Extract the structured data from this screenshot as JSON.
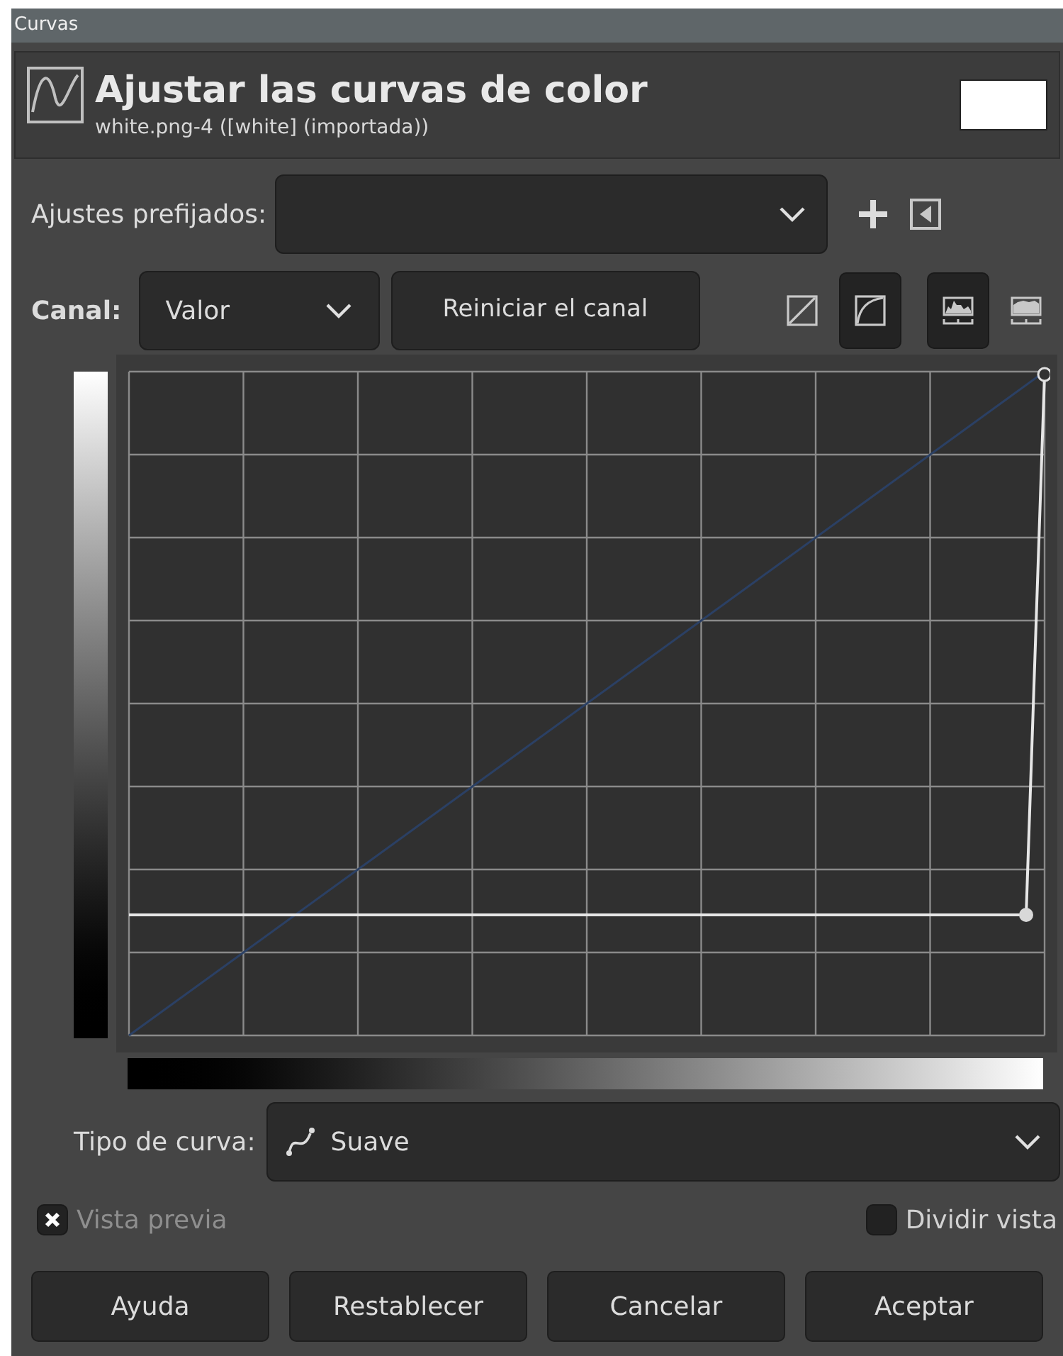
{
  "window": {
    "title": "Curvas"
  },
  "header": {
    "title": "Ajustar las curvas de color",
    "subtitle": "white.png-4 ([white] (importada))"
  },
  "presets": {
    "label": "Ajustes prefijados:"
  },
  "channel": {
    "label": "Canal:",
    "value": "Valor",
    "reset_button": "Reiniciar el canal",
    "curve_modes": [
      {
        "kind": "linear",
        "selected": false
      },
      {
        "kind": "smooth",
        "selected": true
      }
    ],
    "histogram_scales": [
      {
        "kind": "linear",
        "selected": true
      },
      {
        "kind": "logarithmic",
        "selected": false
      }
    ]
  },
  "curve_type": {
    "label": "Tipo de curva:",
    "value": "Suave"
  },
  "options": [
    {
      "label": "Vista previa",
      "checked": true,
      "disabled": true
    },
    {
      "label": "Dividir vista",
      "checked": false,
      "disabled": false
    }
  ],
  "buttons": [
    "Ayuda",
    "Restablecer",
    "Cancelar",
    "Aceptar"
  ]
}
